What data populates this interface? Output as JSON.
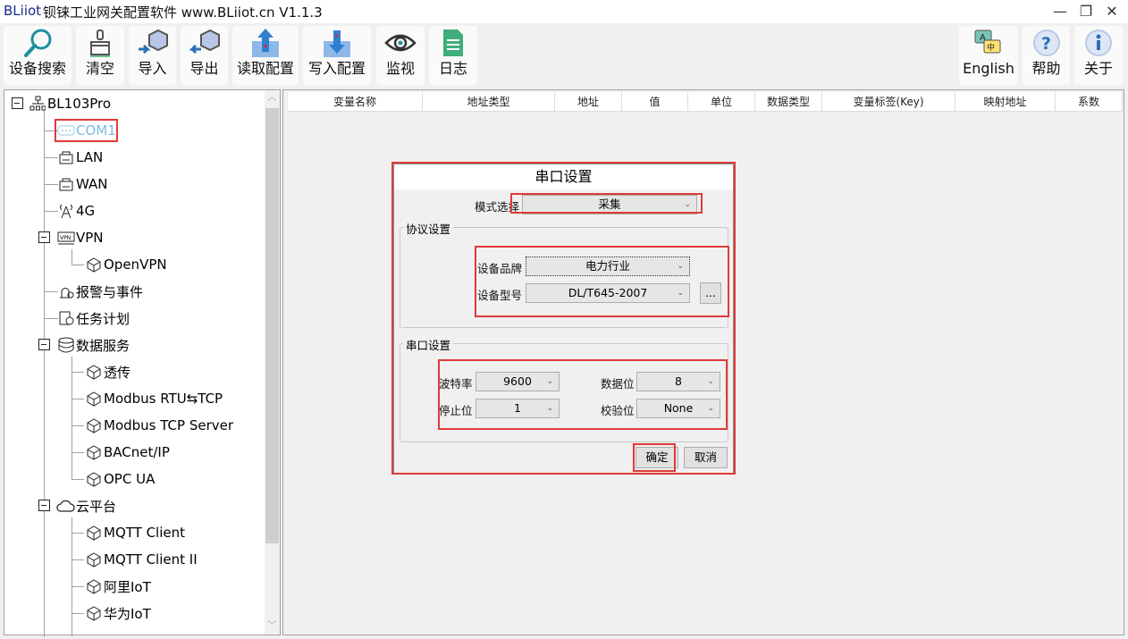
{
  "window": {
    "brand": "BLiiot",
    "title": "钡铼工业网关配置软件 www.BLiiot.cn V1.1.3",
    "minimize": "—",
    "restore": "❐",
    "close": "✕"
  },
  "toolbar": {
    "left": [
      {
        "label": "设备搜索",
        "icon": "search-icon"
      },
      {
        "label": "清空",
        "icon": "broom-icon"
      },
      {
        "label": "导入",
        "icon": "import-icon"
      },
      {
        "label": "导出",
        "icon": "export-icon"
      },
      {
        "label": "读取配置",
        "icon": "upload-icon"
      },
      {
        "label": "写入配置",
        "icon": "download-icon"
      },
      {
        "label": "监视",
        "icon": "eye-icon"
      },
      {
        "label": "日志",
        "icon": "log-icon"
      }
    ],
    "right": [
      {
        "label": "English",
        "icon": "language-icon"
      },
      {
        "label": "帮助",
        "icon": "help-icon"
      },
      {
        "label": "关于",
        "icon": "info-icon"
      }
    ]
  },
  "tree": {
    "root": "BL103Pro",
    "items": [
      {
        "label": "COM1",
        "icon": "serial-port-icon",
        "selected": true
      },
      {
        "label": "LAN",
        "icon": "ethernet-icon"
      },
      {
        "label": "WAN",
        "icon": "ethernet-icon"
      },
      {
        "label": "4G",
        "icon": "antenna-icon"
      },
      {
        "label": "VPN",
        "icon": "vpn-icon"
      },
      {
        "label": "OpenVPN",
        "icon": "cube-icon"
      },
      {
        "label": "报警与事件",
        "icon": "alarm-icon"
      },
      {
        "label": "任务计划",
        "icon": "schedule-icon"
      },
      {
        "label": "数据服务",
        "icon": "database-icon"
      },
      {
        "label": "透传",
        "icon": "cube-icon"
      },
      {
        "label": "Modbus RTU⇆TCP",
        "icon": "cube-icon"
      },
      {
        "label": "Modbus TCP Server",
        "icon": "cube-icon"
      },
      {
        "label": "BACnet/IP",
        "icon": "cube-icon"
      },
      {
        "label": "OPC UA",
        "icon": "cube-icon"
      },
      {
        "label": "云平台",
        "icon": "cloud-icon"
      },
      {
        "label": "MQTT Client",
        "icon": "cube-icon"
      },
      {
        "label": "MQTT Client II",
        "icon": "cube-icon"
      },
      {
        "label": "阿里IoT",
        "icon": "cube-icon"
      },
      {
        "label": "华为IoT",
        "icon": "cube-icon"
      }
    ]
  },
  "table": {
    "columns": [
      "变量名称",
      "地址类型",
      "地址",
      "值",
      "单位",
      "数据类型",
      "变量标签(Key)",
      "映射地址",
      "系数"
    ]
  },
  "dialog": {
    "title": "串口设置",
    "mode_label": "模式选择",
    "mode_value": "采集",
    "protocol_group": "协议设置",
    "brand_label": "设备品牌",
    "brand_value": "电力行业",
    "model_label": "设备型号",
    "model_value": "DL/T645-2007",
    "more_button": "...",
    "serial_group": "串口设置",
    "baud_label": "波特率",
    "baud_value": "9600",
    "databits_label": "数据位",
    "databits_value": "8",
    "stopbits_label": "停止位",
    "stopbits_value": "1",
    "parity_label": "校验位",
    "parity_value": "None",
    "ok": "确定",
    "cancel": "取消"
  },
  "colors": {
    "highlight": "#e03a3a",
    "selected_text": "#7fb8e0"
  }
}
